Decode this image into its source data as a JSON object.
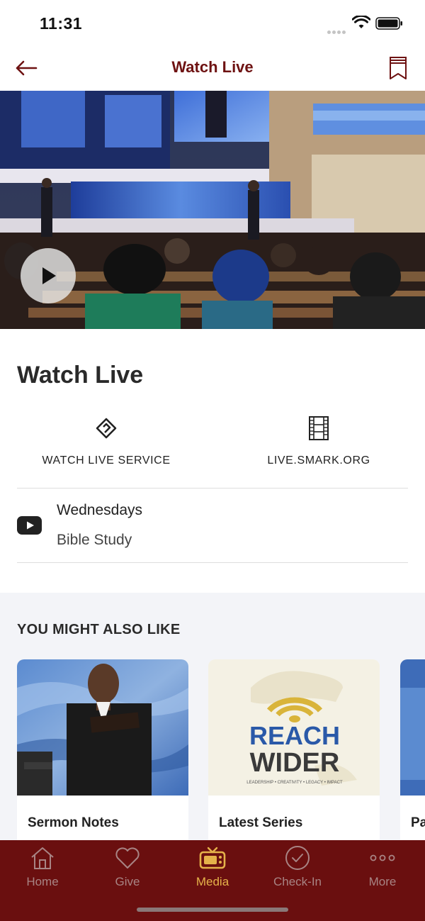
{
  "status_bar": {
    "time": "11:31"
  },
  "header": {
    "title": "Watch Live"
  },
  "content": {
    "heading": "Watch Live",
    "actions": [
      {
        "label": "WATCH LIVE SERVICE",
        "icon": "link-icon"
      },
      {
        "label": "LIVE.SMARK.ORG",
        "icon": "film-strip-icon"
      }
    ],
    "schedule_item": {
      "line1": "Wednesdays",
      "line2": "Bible Study",
      "icon": "youtube-icon"
    }
  },
  "recommendations": {
    "heading": "YOU MIGHT ALSO LIKE",
    "cards": [
      {
        "title": "Sermon Notes"
      },
      {
        "title": "Latest Series",
        "artwork_text": "REACH WIDER",
        "artwork_tagline": "LEADERSHIP • CREATIVITY • LEGACY • IMPACT"
      },
      {
        "title": "Pa"
      }
    ]
  },
  "tab_bar": {
    "items": [
      {
        "label": "Home",
        "icon": "home-icon"
      },
      {
        "label": "Give",
        "icon": "heart-icon"
      },
      {
        "label": "Media",
        "icon": "tv-icon",
        "active": true
      },
      {
        "label": "Check-In",
        "icon": "check-circle-icon"
      },
      {
        "label": "More",
        "icon": "more-dots-icon"
      }
    ]
  },
  "colors": {
    "brand": "#6e1212",
    "tab_bg": "#6a0f0f",
    "active_tab": "#e5b24a",
    "inactive_tab": "#a88484"
  }
}
